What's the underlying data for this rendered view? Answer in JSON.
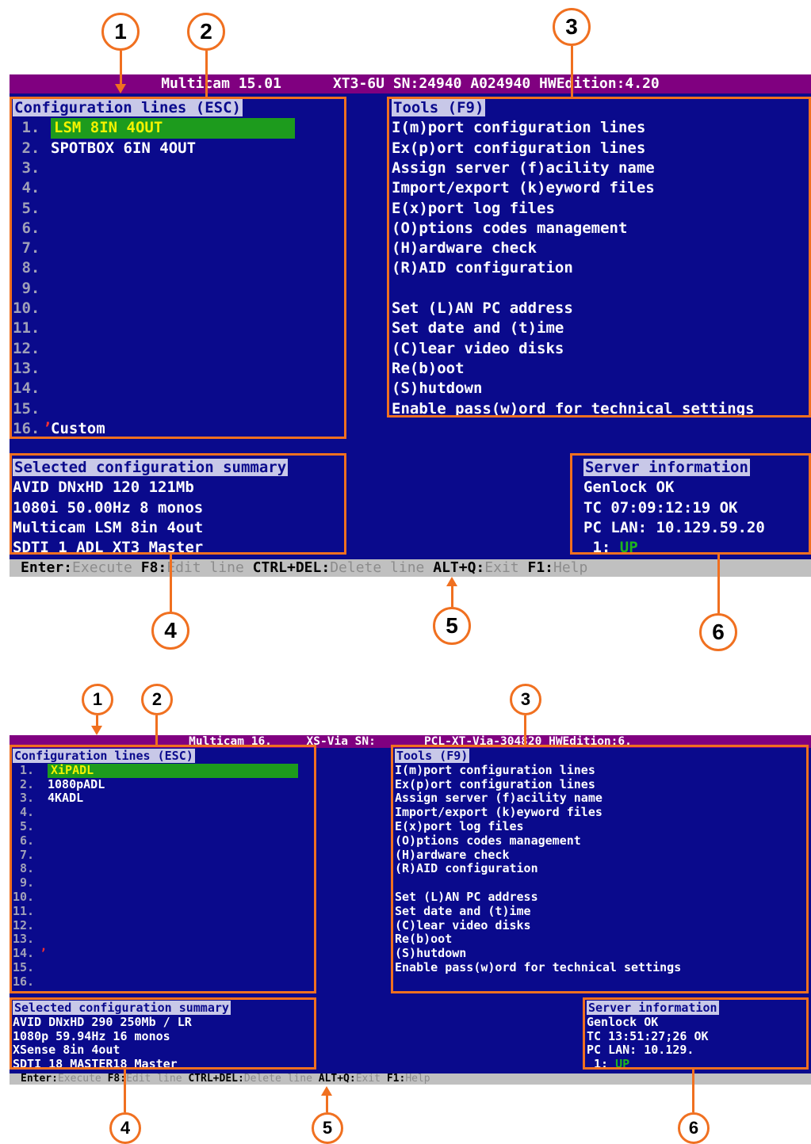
{
  "top": {
    "title": "Multicam 15.01      XT3-6U SN:24940 A024940 HWEdition:4.20",
    "config": {
      "header": "Configuration lines (ESC)",
      "lines": [
        {
          "num": " 1.",
          "label": "LSM 8IN 4OUT"
        },
        {
          "num": " 2.",
          "label": "SPOTBOX 6IN 4OUT"
        },
        {
          "num": " 3.",
          "label": ""
        },
        {
          "num": " 4.",
          "label": ""
        },
        {
          "num": " 5.",
          "label": ""
        },
        {
          "num": " 6.",
          "label": ""
        },
        {
          "num": " 7.",
          "label": ""
        },
        {
          "num": " 8.",
          "label": ""
        },
        {
          "num": " 9.",
          "label": ""
        },
        {
          "num": "10.",
          "label": ""
        },
        {
          "num": "11.",
          "label": ""
        },
        {
          "num": "12.",
          "label": ""
        },
        {
          "num": "13.",
          "label": ""
        },
        {
          "num": "14.",
          "label": ""
        },
        {
          "num": "15.",
          "label": ""
        },
        {
          "num": "16.",
          "label": "Custom"
        }
      ]
    },
    "tools": {
      "header": "Tools (F9)",
      "items": [
        "I(m)port configuration lines",
        "Ex(p)ort configuration lines",
        "Assign server (f)acility name",
        "Import/export (k)eyword files",
        "E(x)port log files",
        "(O)ptions codes management",
        "(H)ardware check",
        "(R)AID configuration",
        "",
        "Set (L)AN PC address",
        "Set date and (t)ime",
        "(C)lear video disks",
        "Re(b)oot",
        "(S)hutdown",
        "Enable pass(w)ord for technical settings"
      ]
    },
    "summary": {
      "header": "Selected configuration summary",
      "lines": [
        "AVID DNxHD 120 121Mb",
        "1080i 50.00Hz 8 monos",
        "Multicam LSM 8in 4out",
        "SDTI 1 ADL XT3 Master"
      ]
    },
    "server": {
      "header": "Server information",
      "lines": [
        "Genlock OK",
        "TC 07:09:12:19 OK",
        "PC LAN: 10.129.59.20"
      ],
      "port_num": " 1: ",
      "port_status": "UP"
    }
  },
  "bottom": {
    "title": "Multicam 16.     XS-Via SN:       PCL-XT-Via-304820 HWEdition:6.",
    "config": {
      "header": "Configuration lines (ESC)",
      "lines": [
        {
          "num": " 1.",
          "label": "XiPADL"
        },
        {
          "num": " 2.",
          "label": "1080pADL"
        },
        {
          "num": " 3.",
          "label": "4KADL"
        },
        {
          "num": " 4.",
          "label": ""
        },
        {
          "num": " 5.",
          "label": ""
        },
        {
          "num": " 6.",
          "label": ""
        },
        {
          "num": " 7.",
          "label": ""
        },
        {
          "num": " 8.",
          "label": ""
        },
        {
          "num": " 9.",
          "label": ""
        },
        {
          "num": "10.",
          "label": ""
        },
        {
          "num": "11.",
          "label": ""
        },
        {
          "num": "12.",
          "label": ""
        },
        {
          "num": "13.",
          "label": ""
        },
        {
          "num": "14.",
          "label": ""
        },
        {
          "num": "15.",
          "label": ""
        },
        {
          "num": "16.",
          "label": ""
        }
      ]
    },
    "tools": {
      "header": "Tools (F9)",
      "items": [
        "I(m)port configuration lines",
        "Ex(p)ort configuration lines",
        "Assign server (f)acility name",
        "Import/export (k)eyword files",
        "E(x)port log files",
        "(O)ptions codes management",
        "(H)ardware check",
        "(R)AID configuration",
        "",
        "Set (L)AN PC address",
        "Set date and (t)ime",
        "(C)lear video disks",
        "Re(b)oot",
        "(S)hutdown",
        "Enable pass(w)ord for technical settings"
      ]
    },
    "summary": {
      "header": "Selected configuration summary",
      "lines": [
        "AVID DNxHD 290 250Mb / LR",
        "1080p 59.94Hz 16 monos",
        "XSense 8in 4out",
        "SDTI 18 MASTER18 Master"
      ]
    },
    "server": {
      "header": "Server information",
      "lines": [
        "Genlock OK",
        "TC 13:51:27;26 OK",
        "PC LAN: 10.129."
      ],
      "port_num": " 1: ",
      "port_status": "UP"
    }
  },
  "statusbar": [
    {
      "key": "Enter:",
      "action": "Execute"
    },
    {
      "key": "F8:",
      "action": "Edit line"
    },
    {
      "key": "CTRL+DEL:",
      "action": "Delete line"
    },
    {
      "key": "ALT+Q:",
      "action": "Exit"
    },
    {
      "key": "F1:",
      "action": "Help"
    }
  ],
  "callouts": [
    "1",
    "2",
    "3",
    "4",
    "5",
    "6"
  ],
  "colors": {
    "screen_bg": "#0a0a8c",
    "title_bg": "#800080",
    "selection_bg": "#1d9b1d",
    "selection_fg": "#f2f200",
    "annotation": "#f07020",
    "status_bg": "#c0c0c0"
  }
}
